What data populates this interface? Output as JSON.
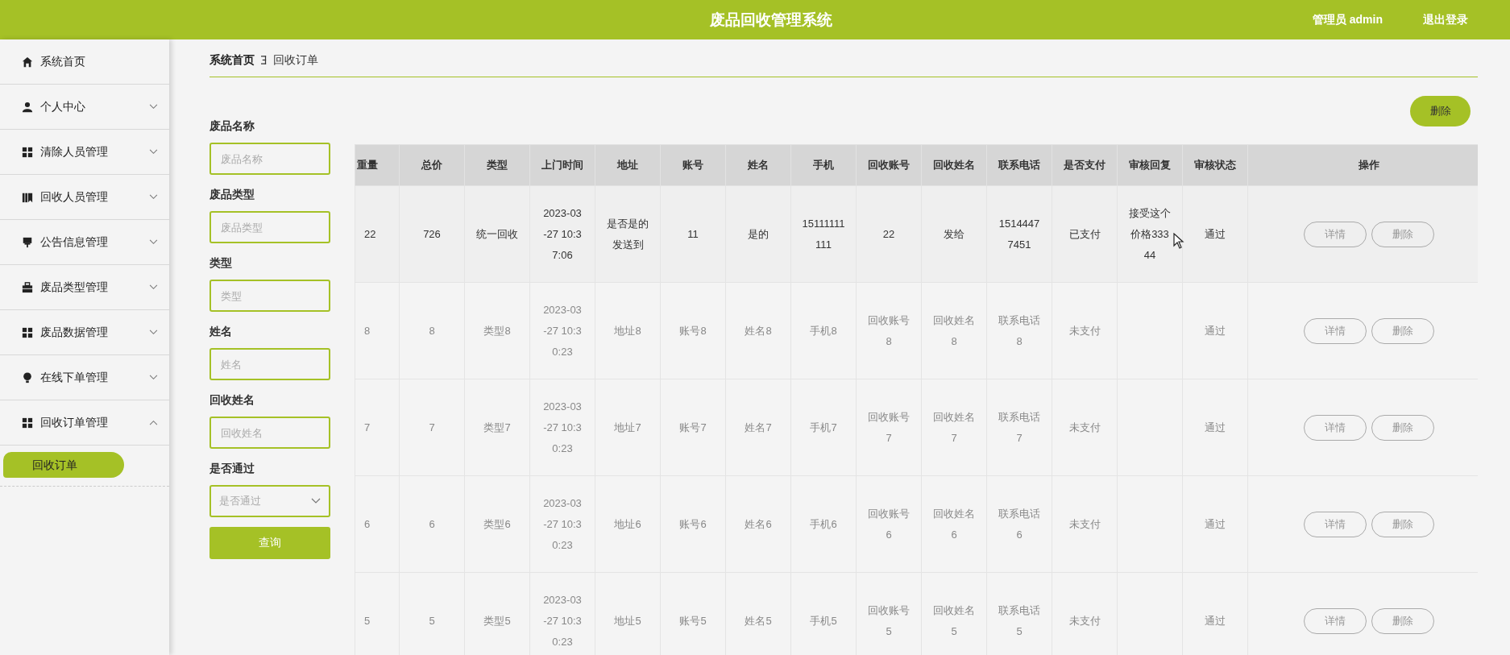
{
  "header": {
    "title": "废品回收管理系统",
    "user": "管理员 admin",
    "logout": "退出登录"
  },
  "sidebar": {
    "items": [
      {
        "label": "系统首页",
        "kind": "link"
      },
      {
        "label": "个人中心",
        "kind": "menu",
        "expanded": false
      },
      {
        "label": "清除人员管理",
        "kind": "menu",
        "expanded": false
      },
      {
        "label": "回收人员管理",
        "kind": "menu",
        "expanded": false
      },
      {
        "label": "公告信息管理",
        "kind": "menu",
        "expanded": false
      },
      {
        "label": "废品类型管理",
        "kind": "menu",
        "expanded": false
      },
      {
        "label": "废品数据管理",
        "kind": "menu",
        "expanded": false
      },
      {
        "label": "在线下单管理",
        "kind": "menu",
        "expanded": false
      },
      {
        "label": "回收订单管理",
        "kind": "menu",
        "expanded": true,
        "children": [
          {
            "label": "回收订单",
            "selected": true
          }
        ]
      }
    ]
  },
  "breadcrumb": [
    "系统首页",
    "回收订单"
  ],
  "filters": [
    {
      "label": "废品名称",
      "placeholder": "废品名称",
      "kind": "text"
    },
    {
      "label": "废品类型",
      "placeholder": "废品类型",
      "kind": "text"
    },
    {
      "label": "类型",
      "placeholder": "类型",
      "kind": "text"
    },
    {
      "label": "姓名",
      "placeholder": "姓名",
      "kind": "text"
    },
    {
      "label": "回收姓名",
      "placeholder": "回收姓名",
      "kind": "text"
    },
    {
      "label": "是否通过",
      "placeholder": "是否通过",
      "kind": "select"
    }
  ],
  "query_button": "查询",
  "bulk_delete_button": "删除",
  "table": {
    "columns": [
      "重量",
      "总价",
      "类型",
      "上门时间",
      "地址",
      "账号",
      "姓名",
      "手机",
      "回收账号",
      "回收姓名",
      "联系电话",
      "是否支付",
      "审核回复",
      "审核状态",
      "操作"
    ],
    "rows": [
      {
        "hovered": true,
        "cells": [
          "22",
          "726",
          "统一回收",
          "2023-03-27 10:37:06",
          "是否是的发送到",
          "11",
          "是的",
          "15111111111",
          "22",
          "发给",
          "15144477451",
          "已支付",
          "接受这个价格33344",
          "通过"
        ],
        "actions": [
          "详情",
          "删除"
        ]
      },
      {
        "hovered": false,
        "cells": [
          "8",
          "8",
          "类型8",
          "2023-03-27 10:30:23",
          "地址8",
          "账号8",
          "姓名8",
          "手机8",
          "回收账号8",
          "回收姓名8",
          "联系电话8",
          "未支付",
          "",
          "通过"
        ],
        "actions": [
          "详情",
          "删除"
        ]
      },
      {
        "hovered": false,
        "cells": [
          "7",
          "7",
          "类型7",
          "2023-03-27 10:30:23",
          "地址7",
          "账号7",
          "姓名7",
          "手机7",
          "回收账号7",
          "回收姓名7",
          "联系电话7",
          "未支付",
          "",
          "通过"
        ],
        "actions": [
          "详情",
          "删除"
        ]
      },
      {
        "hovered": false,
        "cells": [
          "6",
          "6",
          "类型6",
          "2023-03-27 10:30:23",
          "地址6",
          "账号6",
          "姓名6",
          "手机6",
          "回收账号6",
          "回收姓名6",
          "联系电话6",
          "未支付",
          "",
          "通过"
        ],
        "actions": [
          "详情",
          "删除"
        ]
      },
      {
        "hovered": false,
        "cells": [
          "5",
          "5",
          "类型5",
          "2023-03-27 10:30:23",
          "地址5",
          "账号5",
          "姓名5",
          "手机5",
          "回收账号5",
          "回收姓名5",
          "联系电话5",
          "未支付",
          "",
          "通过"
        ],
        "actions": [
          "详情",
          "删除"
        ]
      }
    ]
  }
}
